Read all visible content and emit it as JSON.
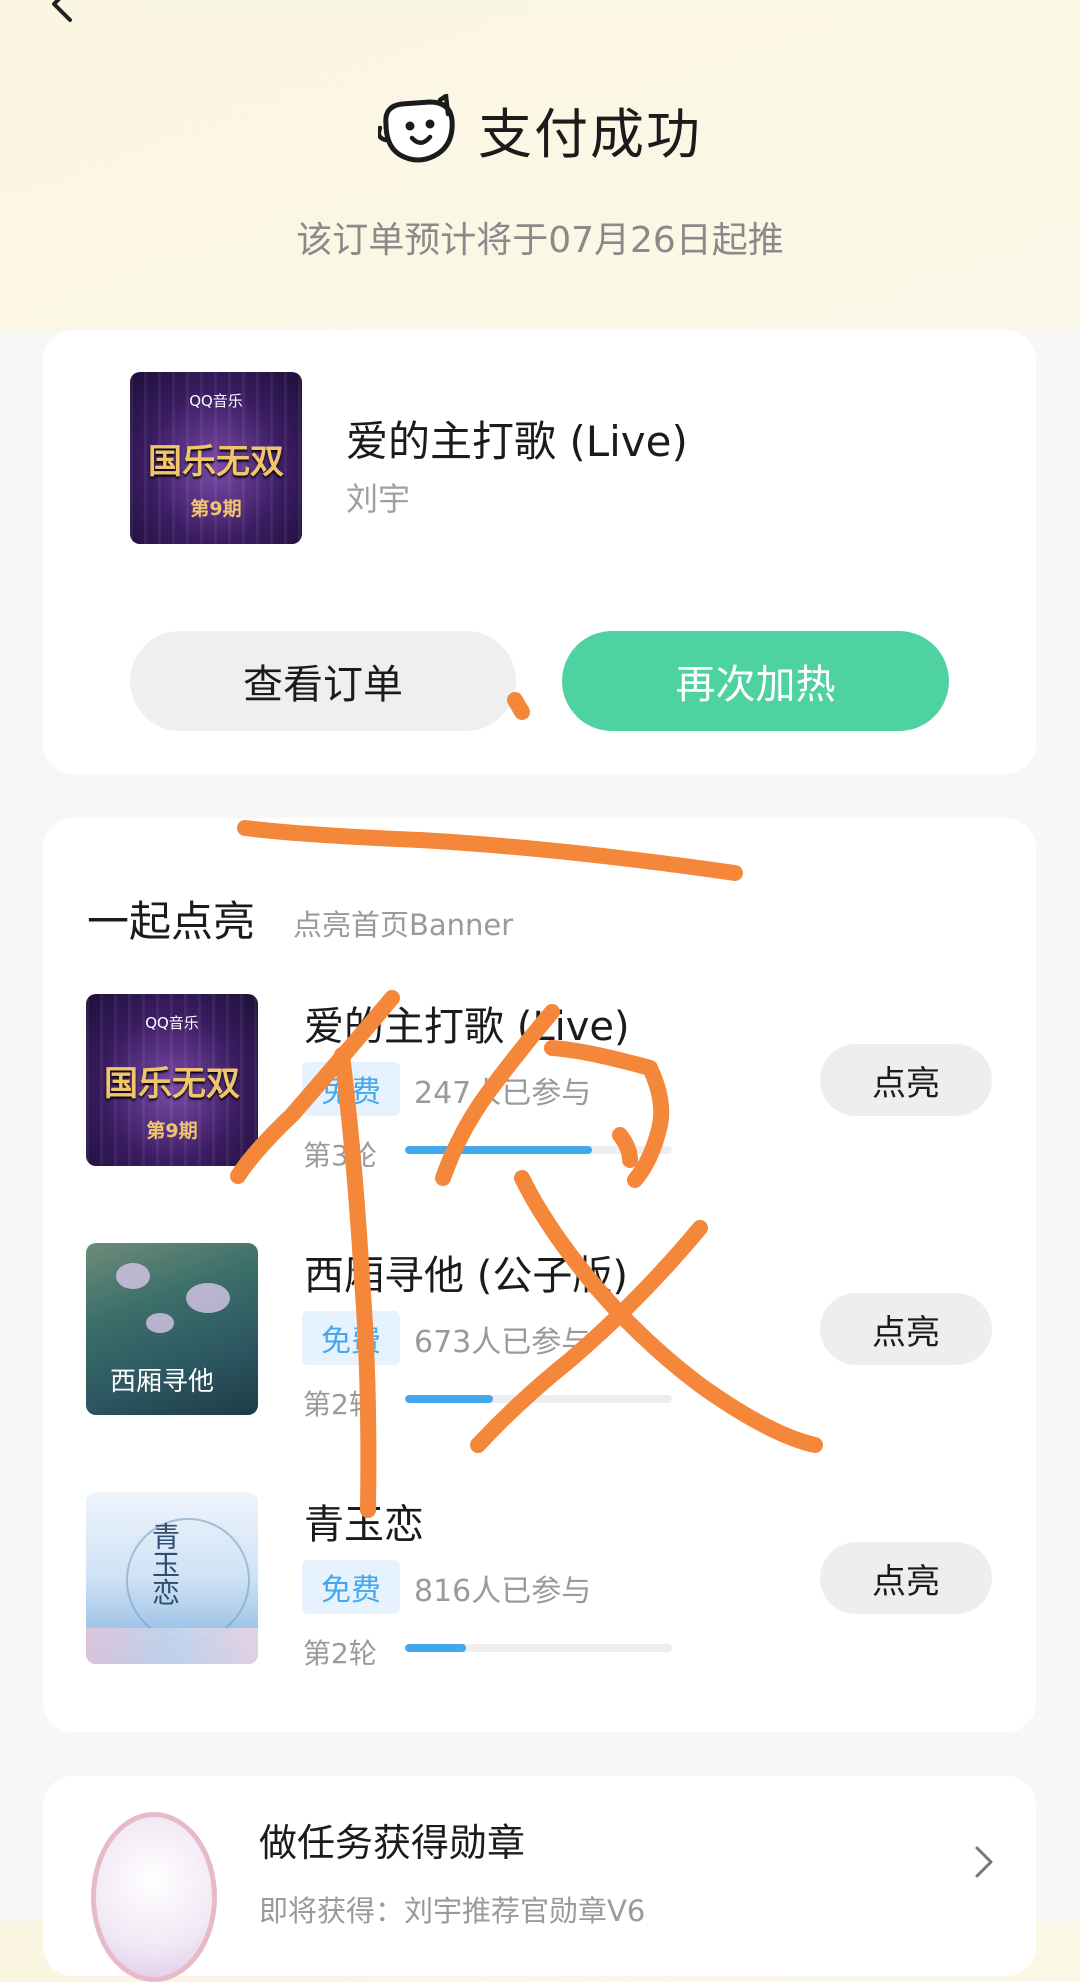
{
  "header": {
    "title": "支付成功",
    "notice": "该订单预计将于07月26日起推"
  },
  "order": {
    "song_title": "爱的主打歌 (Live)",
    "artist": "刘宇",
    "cover": {
      "logo": "QQ音乐",
      "show": "国乐无双",
      "issue": "第9期"
    },
    "view_order_label": "查看订单",
    "boost_again_label": "再次加热"
  },
  "light_up": {
    "title": "一起点亮",
    "subtitle": "点亮首页Banner",
    "items": [
      {
        "name": "爱的主打歌 (Live)",
        "tag": "免费",
        "joined": "247人已参与",
        "round": "第3轮",
        "progress": 0.7,
        "button": "点亮",
        "cover": {
          "logo": "QQ音乐",
          "show": "国乐无双",
          "issue": "第9期"
        }
      },
      {
        "name": "西厢寻他 (公子版)",
        "tag": "免费",
        "joined": "673人已参与",
        "round": "第2轮",
        "progress": 0.33,
        "button": "点亮",
        "cover": {
          "calligraphy": "西厢寻他"
        }
      },
      {
        "name": "青玉恋",
        "tag": "免费",
        "joined": "816人已参与",
        "round": "第2轮",
        "progress": 0.23,
        "button": "点亮",
        "cover": {
          "calligraphy": "青玉恋"
        }
      }
    ]
  },
  "task": {
    "title": "做任务获得勋章",
    "subtitle": "即将获得：刘宇推荐官勋章V6"
  },
  "colors": {
    "accent_green": "#4fd2a2",
    "progress_blue": "#43a7ee",
    "scribble_orange": "#f5873a"
  }
}
